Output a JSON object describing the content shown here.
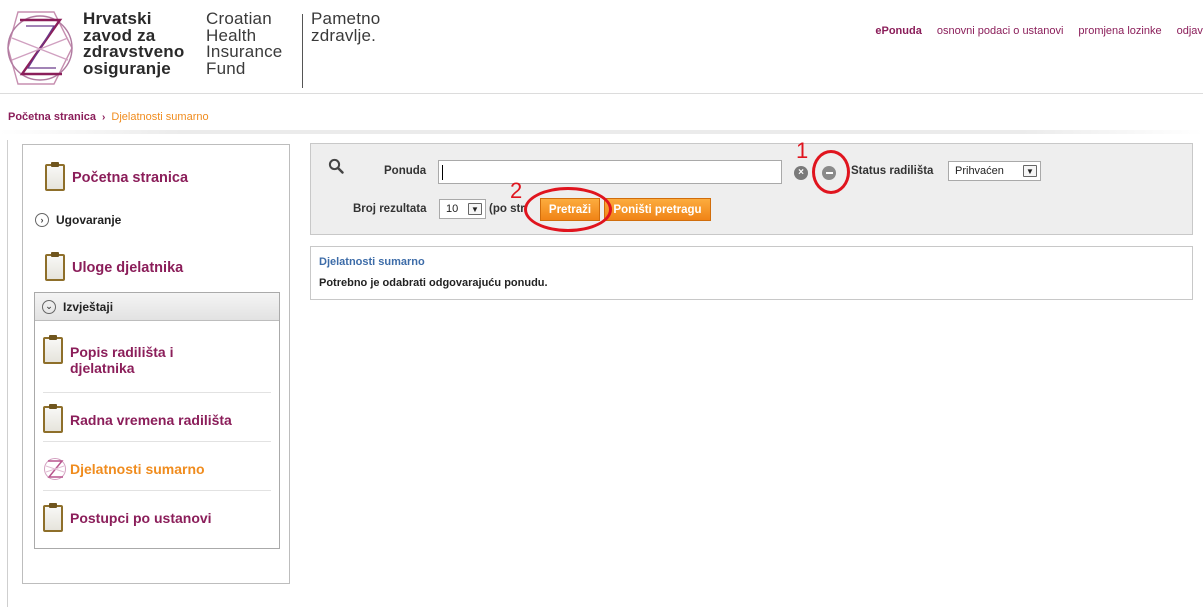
{
  "header": {
    "org_hr": [
      "Hrvatski",
      "zavod za",
      "zdravstveno",
      "osiguranje"
    ],
    "org_en": [
      "Croatian",
      "Health",
      "Insurance",
      "Fund"
    ],
    "slogan": [
      "Pametno",
      "zdravlje."
    ],
    "nav": [
      {
        "label": "ePonuda",
        "active": true
      },
      {
        "label": "osnovni podaci o ustanovi",
        "active": false
      },
      {
        "label": "promjena lozinke",
        "active": false
      },
      {
        "label": "odjava",
        "active": false
      }
    ]
  },
  "breadcrumb": {
    "home": "Početna stranica",
    "separator": "›",
    "current": "Djelatnosti sumarno"
  },
  "sidebar": {
    "home": "Početna stranica",
    "ugovaranje": "Ugovaranje",
    "uloge": "Uloge djelatnika",
    "izvjestaji": "Izvještaji",
    "reports": [
      {
        "line1": "Popis radilišta i",
        "line2": "djelatnika"
      },
      {
        "line1": "Radna vremena radilišta",
        "line2": ""
      },
      {
        "line1": "Djelatnosti sumarno",
        "line2": ""
      },
      {
        "line1": "Postupci po ustanovi",
        "line2": ""
      }
    ]
  },
  "search": {
    "ponuda_label": "Ponuda",
    "ponuda_value": "",
    "clear_glyph": "×",
    "status_label": "Status radilišta",
    "status_value": "Prihvaćen",
    "broj_label": "Broj rezultata",
    "broj_value": "10",
    "per_page_suffix": "(po str",
    "search_button": "Pretraži",
    "reset_button": "Poništi pretragu",
    "dropdown_glyph": "▼"
  },
  "annotations": {
    "step1": "1",
    "step2": "2",
    "color": "#e0141e"
  },
  "results": {
    "title": "Djelatnosti sumarno",
    "message": "Potrebno je odabrati odgovarajuću ponudu."
  },
  "colors": {
    "brand": "#8b1e5a",
    "accent": "#f08c1e",
    "link_blue": "#3d6ca8"
  }
}
